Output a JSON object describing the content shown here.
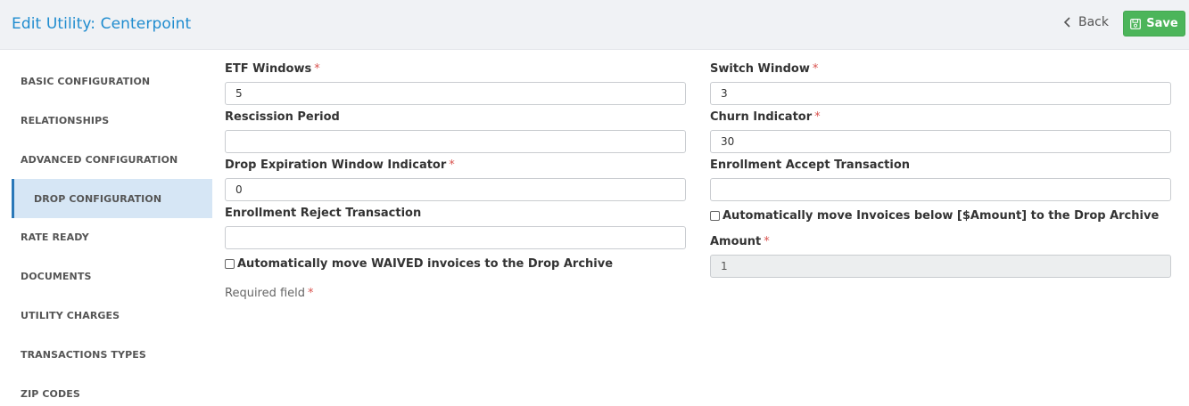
{
  "header": {
    "title": "Edit Utility: Centerpoint",
    "back_label": "Back",
    "save_label": "Save",
    "save_color": "#4cb55a",
    "title_color": "#1f8ccf"
  },
  "sidebar": {
    "items": [
      {
        "label": "BASIC CONFIGURATION"
      },
      {
        "label": "RELATIONSHIPS"
      },
      {
        "label": "ADVANCED CONFIGURATION"
      },
      {
        "label": "DROP CONFIGURATION",
        "active": true
      },
      {
        "label": "RATE READY"
      },
      {
        "label": "DOCUMENTS"
      },
      {
        "label": "UTILITY CHARGES"
      },
      {
        "label": "TRANSACTIONS TYPES"
      },
      {
        "label": "ZIP CODES"
      }
    ]
  },
  "form": {
    "etf_windows": {
      "label": "ETF Windows",
      "required": "*",
      "value": "5"
    },
    "rescission_period": {
      "label": "Rescission Period",
      "value": ""
    },
    "drop_expiration": {
      "label": "Drop Expiration Window Indicator",
      "required": "*",
      "value": "0"
    },
    "enrollment_reject": {
      "label": "Enrollment Reject Transaction",
      "value": ""
    },
    "waived_checkbox": {
      "label": "Automatically move WAIVED invoices to the Drop Archive",
      "checked": false
    },
    "switch_window": {
      "label": "Switch Window",
      "required": "*",
      "value": "3"
    },
    "churn_indicator": {
      "label": "Churn Indicator",
      "required": "*",
      "value": "30"
    },
    "enrollment_accept": {
      "label": "Enrollment Accept Transaction",
      "value": ""
    },
    "amount_checkbox": {
      "label": "Automatically move Invoices below [$Amount] to the Drop Archive",
      "checked": false
    },
    "amount": {
      "label": "Amount",
      "required": "*",
      "value": "1"
    },
    "required_note": "Required field",
    "required_mark": "*"
  }
}
